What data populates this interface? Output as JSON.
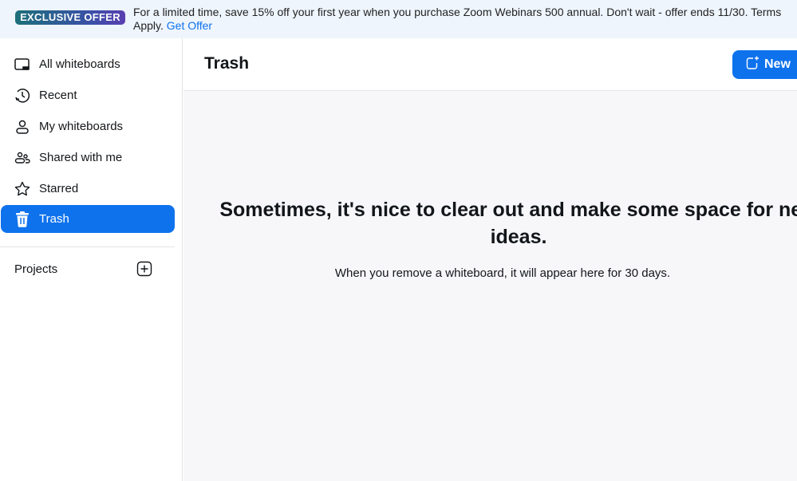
{
  "banner": {
    "badge": "EXCLUSIVE OFFER",
    "text": "For a limited time, save 15% off your first year when you purchase Zoom Webinars 500 annual. Don't wait - offer ends 11/30. Terms Apply.",
    "link": "Get Offer"
  },
  "sidebar": {
    "items": [
      {
        "label": "All whiteboards",
        "icon": "monitor-icon"
      },
      {
        "label": "Recent",
        "icon": "history-icon"
      },
      {
        "label": "My whiteboards",
        "icon": "person-icon"
      },
      {
        "label": "Shared with me",
        "icon": "people-icon"
      },
      {
        "label": "Starred",
        "icon": "star-icon"
      },
      {
        "label": "Trash",
        "icon": "trash-icon",
        "active": true
      }
    ],
    "projects_label": "Projects"
  },
  "main": {
    "title": "Trash",
    "new_label": "New",
    "empty_heading": "Sometimes, it's nice to clear out and make some space for new ideas.",
    "empty_text": "When you remove a whiteboard, it will appear here for 30 days."
  },
  "colors": {
    "accent": "#0e72ed",
    "banner_bg": "#eef5fd"
  }
}
